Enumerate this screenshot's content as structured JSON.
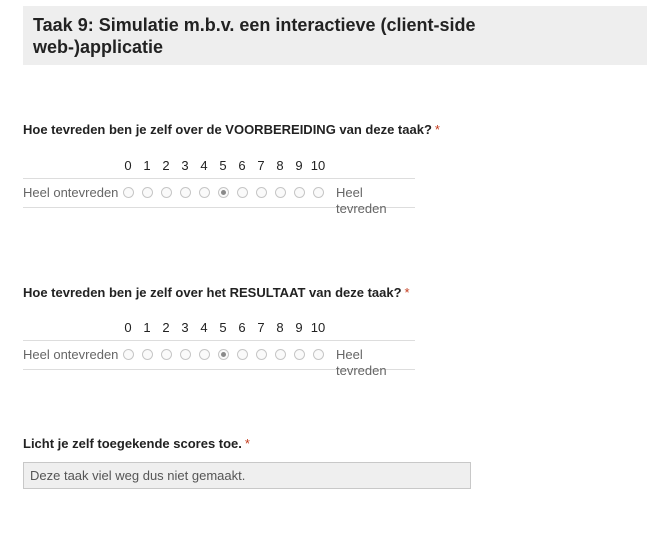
{
  "header": {
    "title": "Taak 9: Simulatie m.b.v. een interactieve (client-side web-)applicatie"
  },
  "questions": [
    {
      "label": "Hoe tevreden ben je zelf over de VOORBEREIDING van deze taak?",
      "required_mark": "*",
      "scale": {
        "numbers": [
          "0",
          "1",
          "2",
          "3",
          "4",
          "5",
          "6",
          "7",
          "8",
          "9",
          "10"
        ],
        "left_label": "Heel ontevreden",
        "right_label": "Heel tevreden",
        "selected": 5
      }
    },
    {
      "label": "Hoe tevreden ben je zelf over het RESULTAAT van deze taak?",
      "required_mark": "*",
      "scale": {
        "numbers": [
          "0",
          "1",
          "2",
          "3",
          "4",
          "5",
          "6",
          "7",
          "8",
          "9",
          "10"
        ],
        "left_label": "Heel ontevreden",
        "right_label": "Heel tevreden",
        "selected": 5
      }
    },
    {
      "label": "Licht je zelf toegekende scores toe.",
      "required_mark": "*",
      "answer": "Deze taak viel weg dus niet gemaakt."
    }
  ],
  "colors": {
    "required": "#c43b1d",
    "header_bg": "#eeeeee"
  }
}
